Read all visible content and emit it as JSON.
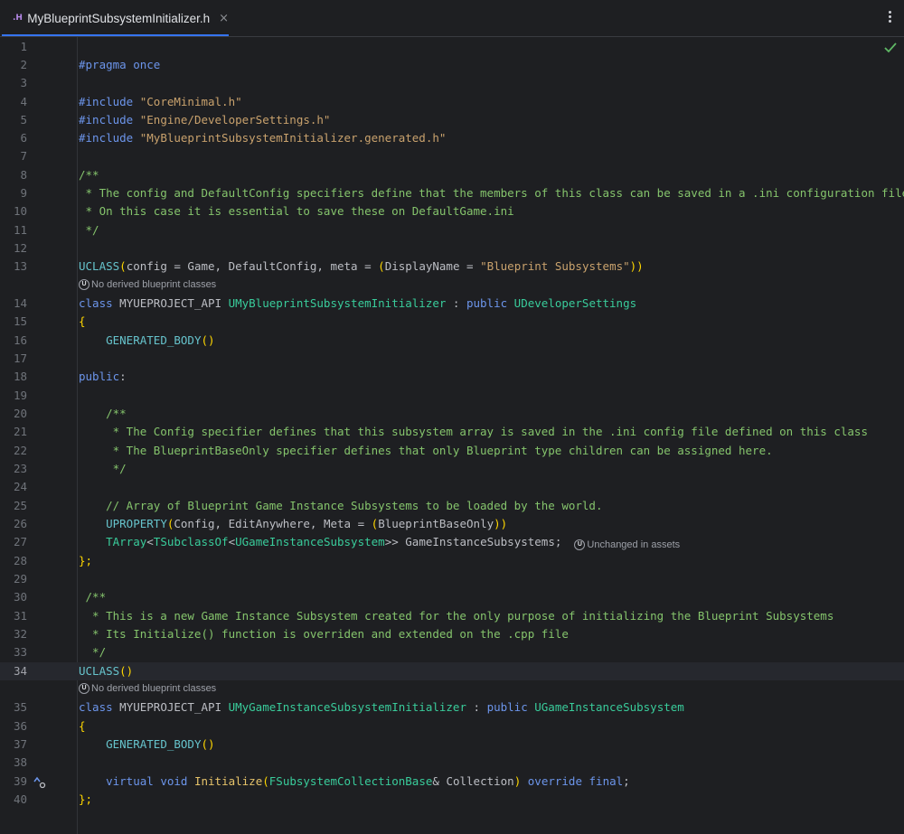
{
  "tab": {
    "icon": ".H",
    "label": "MyBlueprintSubsystemInitializer.h",
    "close": "×"
  },
  "hints": {
    "no_derived": "No derived blueprint classes",
    "unchanged": "Unchanged in assets",
    "badge": "U"
  },
  "lines": {
    "n1": "1",
    "n2": "2",
    "n3": "3",
    "n4": "4",
    "n5": "5",
    "n6": "6",
    "n7": "7",
    "n8": "8",
    "n9": "9",
    "n10": "10",
    "n11": "11",
    "n12": "12",
    "n13": "13",
    "n14": "14",
    "n15": "15",
    "n16": "16",
    "n17": "17",
    "n18": "18",
    "n19": "19",
    "n20": "20",
    "n21": "21",
    "n22": "22",
    "n23": "23",
    "n24": "24",
    "n25": "25",
    "n26": "26",
    "n27": "27",
    "n28": "28",
    "n29": "29",
    "n30": "30",
    "n31": "31",
    "n32": "32",
    "n33": "33",
    "n34": "34",
    "n35": "35",
    "n36": "36",
    "n37": "37",
    "n38": "38",
    "n39": "39",
    "n40": "40"
  },
  "code": {
    "l2_a": "#pragma once",
    "l4_a": "#include",
    "l4_b": " \"CoreMinimal.h\"",
    "l5_a": "#include",
    "l5_b": " \"Engine/DeveloperSettings.h\"",
    "l6_a": "#include",
    "l6_b": " \"MyBlueprintSubsystemInitializer.generated.h\"",
    "l8": "/**",
    "l9": " * The config and DefaultConfig specifiers define that the members of this class can be saved in a .ini configuration file",
    "l10": " * On this case it is essential to save these on DefaultGame.ini",
    "l11": " */",
    "l13_a": "UCLASS",
    "l13_b": "(",
    "l13_c": "config",
    "l13_d": " = Game, ",
    "l13_e": "DefaultConfig",
    "l13_f": ", ",
    "l13_g": "meta",
    "l13_h": " = ",
    "l13_i": "(",
    "l13_j": "DisplayName",
    "l13_k": " = ",
    "l13_l": "\"Blueprint Subsystems\"",
    "l13_m": "))",
    "l14_a": "class",
    "l14_b": " MYUEPROJECT_API ",
    "l14_c": "UMyBlueprintSubsystemInitializer",
    "l14_d": " : ",
    "l14_e": "public",
    "l14_f": " ",
    "l14_g": "UDeveloperSettings",
    "l15": "{",
    "l16_a": "    ",
    "l16_b": "GENERATED_BODY",
    "l16_c": "()",
    "l18_a": "public",
    "l18_b": ":",
    "l20": "    /**",
    "l21": "     * The Config specifier defines that this subsystem array is saved in the .ini config file defined on this class",
    "l22": "     * The BlueprintBaseOnly specifier defines that only Blueprint type children can be assigned here.",
    "l23": "     */",
    "l25": "    // Array of Blueprint Game Instance Subsystems to be loaded by the world.",
    "l26_a": "    ",
    "l26_b": "UPROPERTY",
    "l26_c": "(",
    "l26_d": "Config",
    "l26_e": ", ",
    "l26_f": "EditAnywhere",
    "l26_g": ", ",
    "l26_h": "Meta",
    "l26_i": " = ",
    "l26_j": "(",
    "l26_k": "BlueprintBaseOnly",
    "l26_l": "))",
    "l27_a": "    ",
    "l27_b": "TArray",
    "l27_c": "<",
    "l27_d": "TSubclassOf",
    "l27_e": "<",
    "l27_f": "UGameInstanceSubsystem",
    "l27_g": ">> ",
    "l27_h": "GameInstanceSubsystems",
    "l27_i": ";",
    "l28": "};",
    "l30": " /**",
    "l31": "  * This is a new Game Instance Subsystem created for the only purpose of initializing the Blueprint Subsystems",
    "l32": "  * Its Initialize() function is overriden and extended on the .cpp file",
    "l33": "  */",
    "l34_a": "UCLASS",
    "l34_b": "()",
    "l35_a": "class",
    "l35_b": " MYUEPROJECT_API ",
    "l35_c": "UMyGameInstanceSubsystemInitializer",
    "l35_d": " : ",
    "l35_e": "public",
    "l35_f": " ",
    "l35_g": "UGameInstanceSubsystem",
    "l36": "{",
    "l37_a": "    ",
    "l37_b": "GENERATED_BODY",
    "l37_c": "()",
    "l39_a": "    ",
    "l39_b": "virtual",
    "l39_c": " ",
    "l39_d": "void",
    "l39_e": " ",
    "l39_f": "Initialize",
    "l39_g": "(",
    "l39_h": "FSubsystemCollectionBase",
    "l39_i": "& ",
    "l39_j": "Collection",
    "l39_k": ") ",
    "l39_l": "override",
    "l39_m": " ",
    "l39_n": "final",
    "l39_o": ";",
    "l40": "};"
  }
}
